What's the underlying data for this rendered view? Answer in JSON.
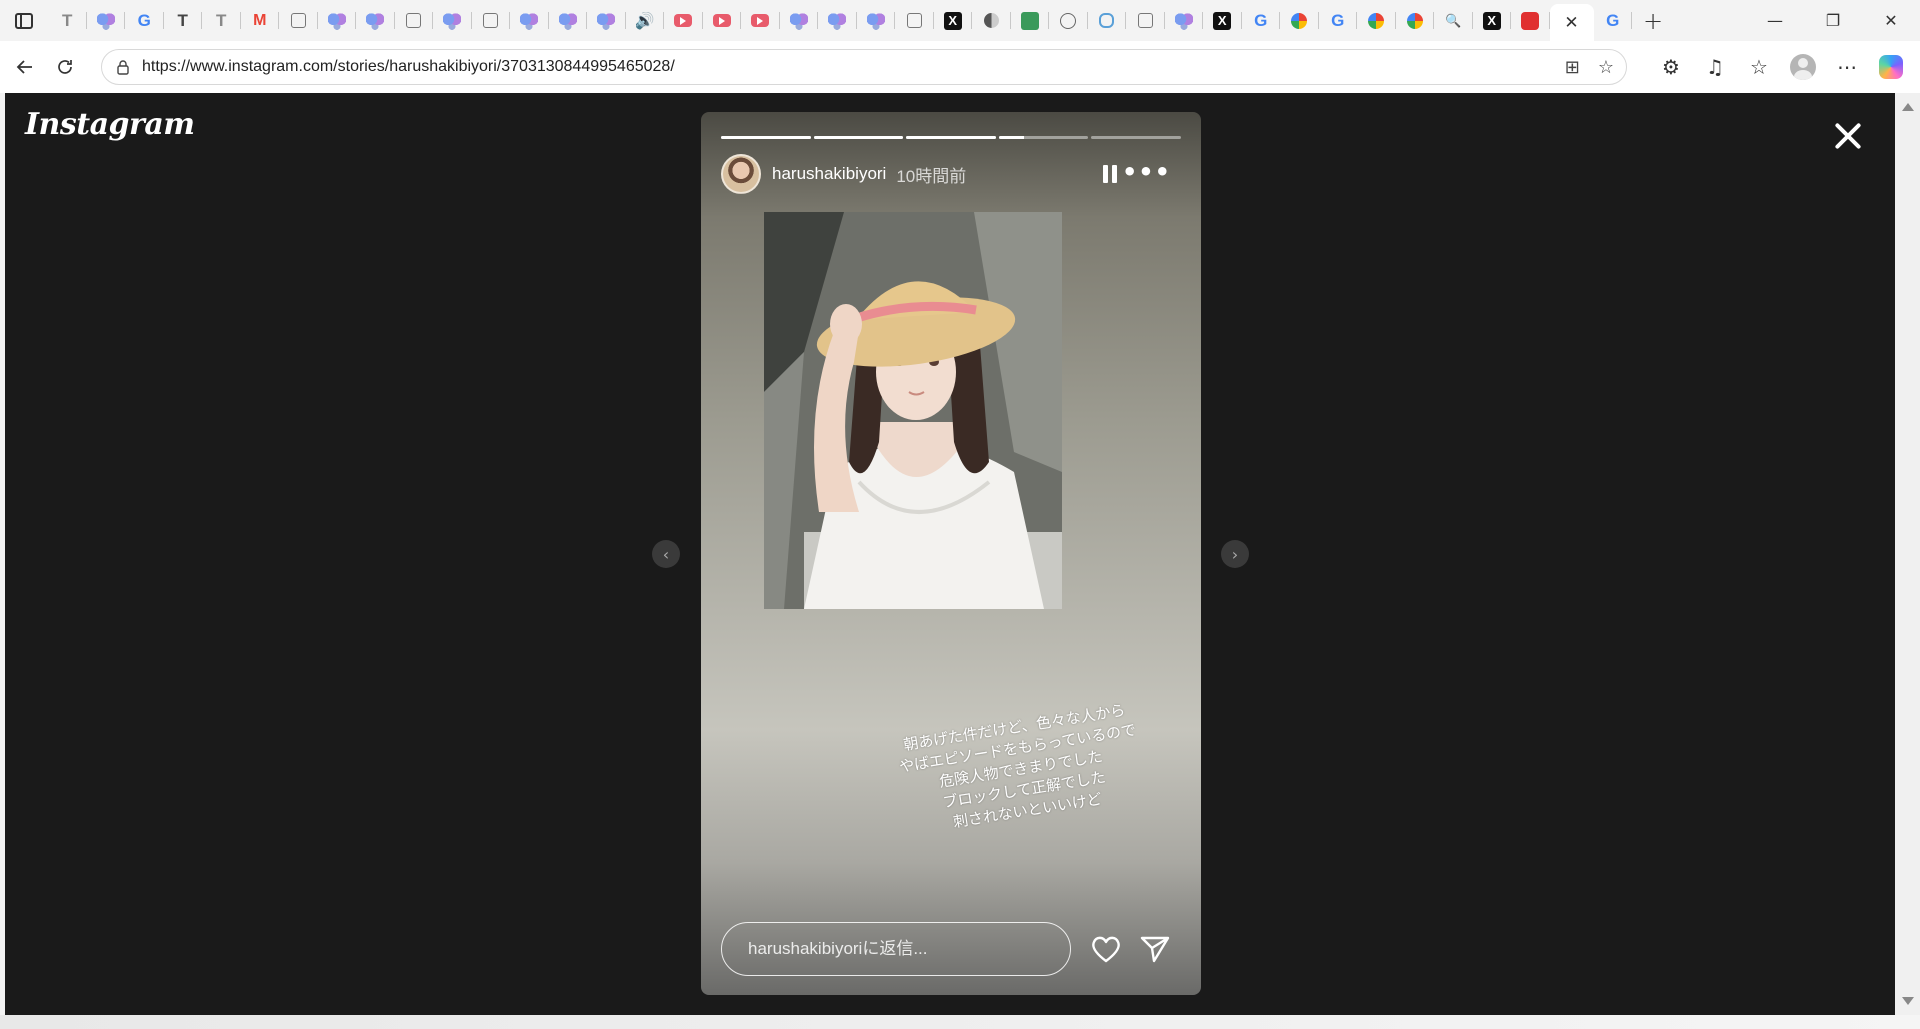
{
  "browser": {
    "tabs": [
      {
        "icon": "text-t-icon",
        "glyph": "T",
        "cls": "Tgray"
      },
      {
        "icon": "butterfly-icon",
        "glyph": "",
        "cls": "butterfly"
      },
      {
        "icon": "google-icon",
        "glyph": "G",
        "cls": "G"
      },
      {
        "icon": "text-t-icon",
        "glyph": "T",
        "cls": "T"
      },
      {
        "icon": "text-t-icon",
        "glyph": "T",
        "cls": "Tgray"
      },
      {
        "icon": "gmail-icon",
        "glyph": "M",
        "cls": "M"
      },
      {
        "icon": "document-icon",
        "glyph": "",
        "cls": "doc"
      },
      {
        "icon": "butterfly-icon",
        "glyph": "",
        "cls": "butterfly"
      },
      {
        "icon": "butterfly-icon",
        "glyph": "",
        "cls": "butterfly"
      },
      {
        "icon": "document-icon",
        "glyph": "",
        "cls": "doc"
      },
      {
        "icon": "butterfly-icon",
        "glyph": "",
        "cls": "butterfly"
      },
      {
        "icon": "document-icon",
        "glyph": "",
        "cls": "doc"
      },
      {
        "icon": "butterfly-icon",
        "glyph": "",
        "cls": "butterfly"
      },
      {
        "icon": "butterfly-icon",
        "glyph": "",
        "cls": "butterfly"
      },
      {
        "icon": "butterfly-icon",
        "glyph": "",
        "cls": "butterfly"
      },
      {
        "icon": "speaker-icon",
        "glyph": "🔊",
        "cls": "speaker"
      },
      {
        "icon": "youtube-icon",
        "glyph": "",
        "cls": "yt"
      },
      {
        "icon": "youtube-icon",
        "glyph": "",
        "cls": "yt"
      },
      {
        "icon": "youtube-icon",
        "glyph": "",
        "cls": "yt"
      },
      {
        "icon": "butterfly-icon",
        "glyph": "",
        "cls": "butterfly"
      },
      {
        "icon": "butterfly-icon",
        "glyph": "",
        "cls": "butterfly"
      },
      {
        "icon": "butterfly-icon",
        "glyph": "",
        "cls": "butterfly"
      },
      {
        "icon": "document-icon",
        "glyph": "",
        "cls": "doc"
      },
      {
        "icon": "x-icon",
        "glyph": "X",
        "cls": "X"
      },
      {
        "icon": "yin-yang-icon",
        "glyph": "",
        "cls": "yin"
      },
      {
        "icon": "green-sheet-icon",
        "glyph": "",
        "cls": "green"
      },
      {
        "icon": "globe-icon",
        "glyph": "",
        "cls": "globe"
      },
      {
        "icon": "ring-icon",
        "glyph": "",
        "cls": "ring"
      },
      {
        "icon": "document-icon",
        "glyph": "",
        "cls": "doc"
      },
      {
        "icon": "butterfly-icon",
        "glyph": "",
        "cls": "butterfly"
      },
      {
        "icon": "x-icon",
        "glyph": "X",
        "cls": "X"
      },
      {
        "icon": "google-icon",
        "glyph": "G",
        "cls": "G"
      },
      {
        "icon": "pinwheel-icon",
        "glyph": "",
        "cls": "pin"
      },
      {
        "icon": "google-icon",
        "glyph": "G",
        "cls": "G"
      },
      {
        "icon": "pinwheel-icon",
        "glyph": "",
        "cls": "pin"
      },
      {
        "icon": "pinwheel-icon",
        "glyph": "",
        "cls": "pin"
      },
      {
        "icon": "search-icon",
        "glyph": "🔍",
        "cls": "search"
      },
      {
        "icon": "x-icon",
        "glyph": "X",
        "cls": "X"
      },
      {
        "icon": "red-app-icon",
        "glyph": "",
        "cls": "red"
      }
    ],
    "active_tab_close": "✕",
    "after_tab_icon": "google-icon",
    "after_tab_glyph": "G",
    "new_tab": "+",
    "url": "https://www.instagram.com/stories/harushakibiyori/3703130844995465028/"
  },
  "page": {
    "logo": "Instagram",
    "prev_glyph": "‹",
    "next_glyph": "›"
  },
  "story": {
    "username": "harushakibiyori",
    "time": "10時間前",
    "more": "•••",
    "progress": [
      1,
      1,
      1,
      0.28,
      0
    ],
    "text": "朝あげた件だけど、色々な人から\nやばエピソードをもらっているので\n危険人物できまりでした\nブロックして正解でした\n刺されないといいけど",
    "reply_placeholder": "harushakibiyoriに返信..."
  }
}
